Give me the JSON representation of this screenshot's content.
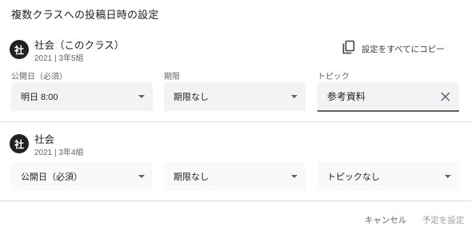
{
  "dialog": {
    "title": "複数クラスへの投稿日時の設定"
  },
  "copy_all": {
    "label": "設定をすべてにコピー",
    "icon": "copy-icon"
  },
  "classes": [
    {
      "avatar": "社",
      "name": "社会（このクラス）",
      "sub": "2021 | 3年5組",
      "labels": {
        "publish": "公開日（必須）",
        "due": "期限",
        "topic": "トピック"
      },
      "publish_value": "明日 8:00",
      "due_value": "期限なし",
      "topic_value": "参考資料"
    },
    {
      "avatar": "社",
      "name": "社会",
      "sub": "2021 | 3年4組",
      "publish_value": "公開日（必須）",
      "due_value": "期限なし",
      "topic_value": "トピックなし"
    }
  ],
  "footer": {
    "cancel": "キャンセル",
    "schedule": "予定を設定"
  },
  "colors": {
    "text": "#202124",
    "secondary": "#5f6368",
    "field_bg": "#f1f3f4",
    "divider": "#dadce0"
  }
}
